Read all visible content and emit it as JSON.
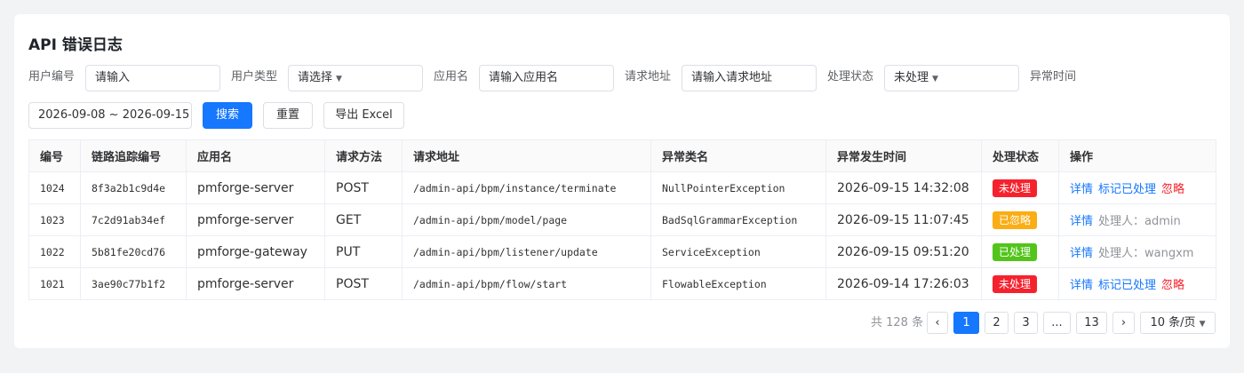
{
  "page": {
    "title": "API 错误日志"
  },
  "filters": {
    "user_id_label": "用户编号",
    "user_id_placeholder": "请输入",
    "user_type_label": "用户类型",
    "user_type_value": "请选择",
    "app_name_label": "应用名",
    "app_name_placeholder": "请输入应用名",
    "request_url_label": "请求地址",
    "request_url_placeholder": "请输入请求地址",
    "status_label": "处理状态",
    "status_value": "未处理",
    "time_label": "异常时间",
    "time_range": "2026-09-08 ~ 2026-09-15"
  },
  "actions": {
    "search": "搜索",
    "reset": "重置",
    "export": "导出 Excel"
  },
  "table": {
    "columns": [
      "编号",
      "链路追踪编号",
      "应用名",
      "请求方法",
      "请求地址",
      "异常类名",
      "异常发生时间",
      "处理状态",
      "操作"
    ],
    "rows": [
      {
        "id": "1024",
        "trace": "8f3a2b1c9d4e",
        "app": "pmforge-server",
        "method": "POST",
        "url": "/admin-api/bpm/instance/terminate",
        "exception": "NullPointerException",
        "time": "2026-09-15 14:32:08",
        "status": "未处理",
        "status_color": "#f5222d",
        "detail": "详情",
        "mark": "标记已处理",
        "ignore": "忽略",
        "handler": ""
      },
      {
        "id": "1023",
        "trace": "7c2d91ab34ef",
        "app": "pmforge-server",
        "method": "GET",
        "url": "/admin-api/bpm/model/page",
        "exception": "BadSqlGrammarException",
        "time": "2026-09-15 11:07:45",
        "status": "已忽略",
        "status_color": "#faad14",
        "detail": "详情",
        "mark": "",
        "ignore": "",
        "handler": "处理人：admin"
      },
      {
        "id": "1022",
        "trace": "5b81fe20cd76",
        "app": "pmforge-gateway",
        "method": "PUT",
        "url": "/admin-api/bpm/listener/update",
        "exception": "ServiceException",
        "time": "2026-09-15 09:51:20",
        "status": "已处理",
        "status_color": "#52c41a",
        "detail": "详情",
        "mark": "",
        "ignore": "",
        "handler": "处理人：wangxm"
      },
      {
        "id": "1021",
        "trace": "3ae90c77b1f2",
        "app": "pmforge-server",
        "method": "POST",
        "url": "/admin-api/bpm/flow/start",
        "exception": "FlowableException",
        "time": "2026-09-14 17:26:03",
        "status": "未处理",
        "status_color": "#f5222d",
        "detail": "详情",
        "mark": "标记已处理",
        "ignore": "忽略",
        "handler": ""
      }
    ]
  },
  "pagination": {
    "total": "共 128 条",
    "prev": "‹",
    "pages": [
      "1",
      "2",
      "3",
      "...",
      "13"
    ],
    "current": "1",
    "next": "›",
    "page_size": "10 条/页"
  },
  "colors": {
    "primary": "#1677ff",
    "danger": "#f5222d",
    "warning": "#faad14",
    "success": "#52c41a"
  }
}
